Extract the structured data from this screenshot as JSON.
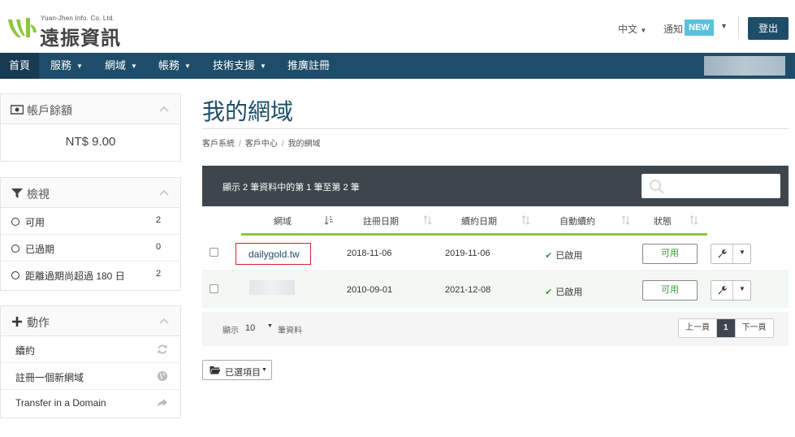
{
  "brand": {
    "company_en": "Yuan-Jhen Info. Co. Ltd.",
    "name": "遠振資訊",
    "accent": "#8cc63e",
    "primary": "#1e4d69"
  },
  "topbar": {
    "language": "中文",
    "notifications_label": "通知",
    "notifications_badge": "NEW",
    "logout": "登出"
  },
  "nav": {
    "items": [
      {
        "label": "首頁",
        "dropdown": false
      },
      {
        "label": "服務",
        "dropdown": true
      },
      {
        "label": "網域",
        "dropdown": true
      },
      {
        "label": "帳務",
        "dropdown": true
      },
      {
        "label": "技術支援",
        "dropdown": true
      },
      {
        "label": "推廣註冊",
        "dropdown": false
      }
    ]
  },
  "sidebar": {
    "balance": {
      "title": "帳戶餘額",
      "amount": "NT$ 9.00"
    },
    "view": {
      "title": "檢視",
      "items": [
        {
          "label": "可用",
          "count": "2"
        },
        {
          "label": "已過期",
          "count": "0"
        },
        {
          "label": "距離過期尚超過 180 日",
          "count": "2"
        }
      ]
    },
    "actions": {
      "title": "動作",
      "items": [
        {
          "label": "續約",
          "icon": "refresh-icon"
        },
        {
          "label": "註冊一個新網域",
          "icon": "globe-icon"
        },
        {
          "label": "Transfer in a Domain",
          "icon": "share-arrow-icon"
        }
      ]
    }
  },
  "main": {
    "title": "我的網域",
    "breadcrumb": [
      "客戶系統",
      "客戶中心",
      "我的網域"
    ],
    "table": {
      "info": "顯示 2 筆資料中的第 1 筆至第 2 筆",
      "columns": [
        "網域",
        "註冊日期",
        "續約日期",
        "自動續約",
        "狀態"
      ],
      "rows": [
        {
          "domain": "dailygold.tw",
          "registered": "2018-11-06",
          "renewal": "2019-11-06",
          "auto_renew": "已啟用",
          "status": "可用"
        },
        {
          "domain": "",
          "registered": "2010-09-01",
          "renewal": "2021-12-08",
          "auto_renew": "已啟用",
          "status": "可用"
        }
      ],
      "footer": {
        "show": "顯示",
        "page_size": "10",
        "suffix": "筆資料"
      },
      "pager": {
        "prev": "上一頁",
        "current": "1",
        "next": "下一頁"
      }
    },
    "selected_items": "已選項目"
  }
}
